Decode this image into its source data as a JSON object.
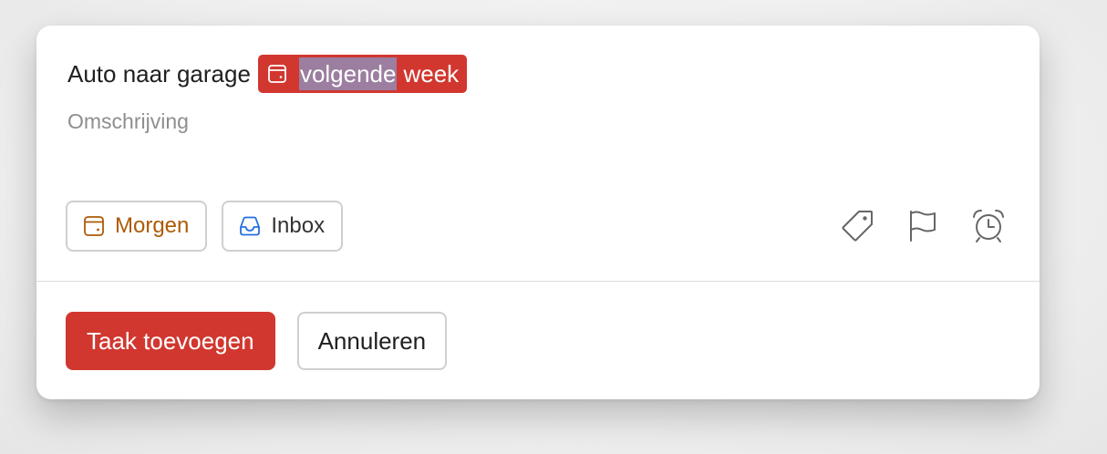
{
  "colors": {
    "accent": "#d1372f",
    "date_orange": "#ad5b06",
    "inbox_blue": "#246fe0",
    "selection": "#9b7ea0",
    "muted_text": "#8e8e8e"
  },
  "task": {
    "title": "Auto naar garage",
    "date_token": {
      "icon": "calendar-icon",
      "selected_text": "volgende",
      "rest_text": "week"
    },
    "description_placeholder": "Omschrijving"
  },
  "chips": {
    "due_date": {
      "icon": "calendar-icon",
      "label": "Morgen"
    },
    "project": {
      "icon": "inbox-icon",
      "label": "Inbox"
    }
  },
  "tools": [
    {
      "icon": "label-tag-icon"
    },
    {
      "icon": "priority-flag-icon"
    },
    {
      "icon": "reminder-alarm-icon"
    }
  ],
  "footer": {
    "add_label": "Taak toevoegen",
    "cancel_label": "Annuleren"
  }
}
